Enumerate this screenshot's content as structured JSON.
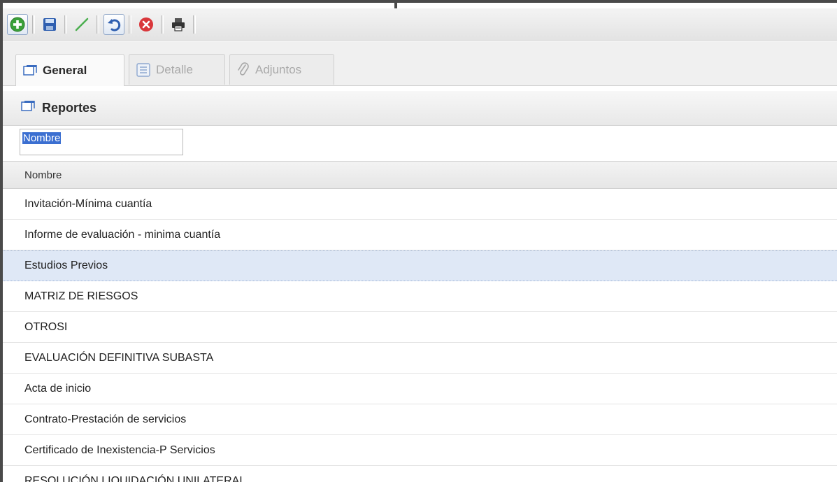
{
  "tabs": [
    {
      "label": "General",
      "icon": "window-icon",
      "active": true
    },
    {
      "label": "Detalle",
      "icon": "detail-list-icon",
      "active": false
    },
    {
      "label": "Adjuntos",
      "icon": "paperclip-icon",
      "active": false
    }
  ],
  "section": {
    "title": "Reportes",
    "icon": "window-icon"
  },
  "filter": {
    "value": "Nombre"
  },
  "grid": {
    "column_header": "Nombre",
    "rows": [
      "Invitación-Mínima cuantía",
      "Informe de evaluación - minima cuantía",
      "Estudios Previos",
      "MATRIZ DE RIESGOS",
      "OTROSI",
      "EVALUACIÓN DEFINITIVA SUBASTA",
      "Acta de inicio",
      "Contrato-Prestación de servicios",
      "Certificado de Inexistencia-P Servicios",
      "RESOLUCIÓN LIQUIDACIÓN UNILATERAL"
    ],
    "selected_row": 2
  },
  "colors": {
    "add": "#3aa03a",
    "save": "#2f5fb0",
    "edit": "#4caf50",
    "delete": "#d9373b",
    "selection": "#dfe8f6",
    "text_selection": "#3b6fd1"
  }
}
